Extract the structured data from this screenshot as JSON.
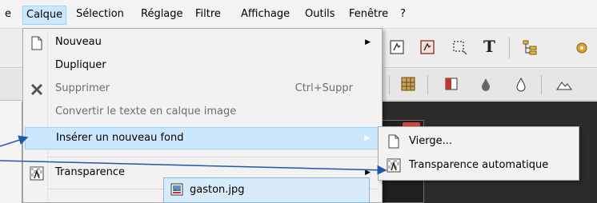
{
  "menubar": {
    "items": [
      {
        "label": "e"
      },
      {
        "label": "Calque"
      },
      {
        "label": "Sélection"
      },
      {
        "label": "Réglage"
      },
      {
        "label": "Filtre"
      },
      {
        "label": "Affichage"
      },
      {
        "label": "Outils"
      },
      {
        "label": "Fenêtre"
      },
      {
        "label": "?"
      }
    ],
    "active_item": "Calque"
  },
  "toolbar": {
    "text_tool_glyph": "T"
  },
  "calque_menu": {
    "items": [
      {
        "label": "Nouveau",
        "icon": "new-page-icon",
        "has_submenu": true,
        "disabled": false
      },
      {
        "label": "Dupliquer",
        "disabled": false
      },
      {
        "label": "Supprimer",
        "icon": "delete-x-icon",
        "shortcut": "Ctrl+Suppr",
        "disabled": true
      },
      {
        "label": "Convertir le texte en calque image",
        "disabled": true
      },
      {
        "label": "Insérer un nouveau fond",
        "has_submenu": true,
        "highlighted": true
      },
      {
        "label": "Transparence",
        "icon": "transparency-icon",
        "has_submenu": true,
        "disabled": false
      }
    ]
  },
  "submenu": {
    "items": [
      {
        "label": "Vierge...",
        "icon": "blank-page-icon"
      },
      {
        "label": "Transparence automatique",
        "icon": "auto-transparency-icon"
      }
    ]
  },
  "file_popup": {
    "label": "gaston.jpg",
    "icon": "image-file-icon"
  },
  "colors": {
    "highlight": "#cce8ff",
    "highlight_border": "#99d1ff",
    "annotation_arrow": "#1f5aa8",
    "workspace": "#2b2b2b"
  }
}
